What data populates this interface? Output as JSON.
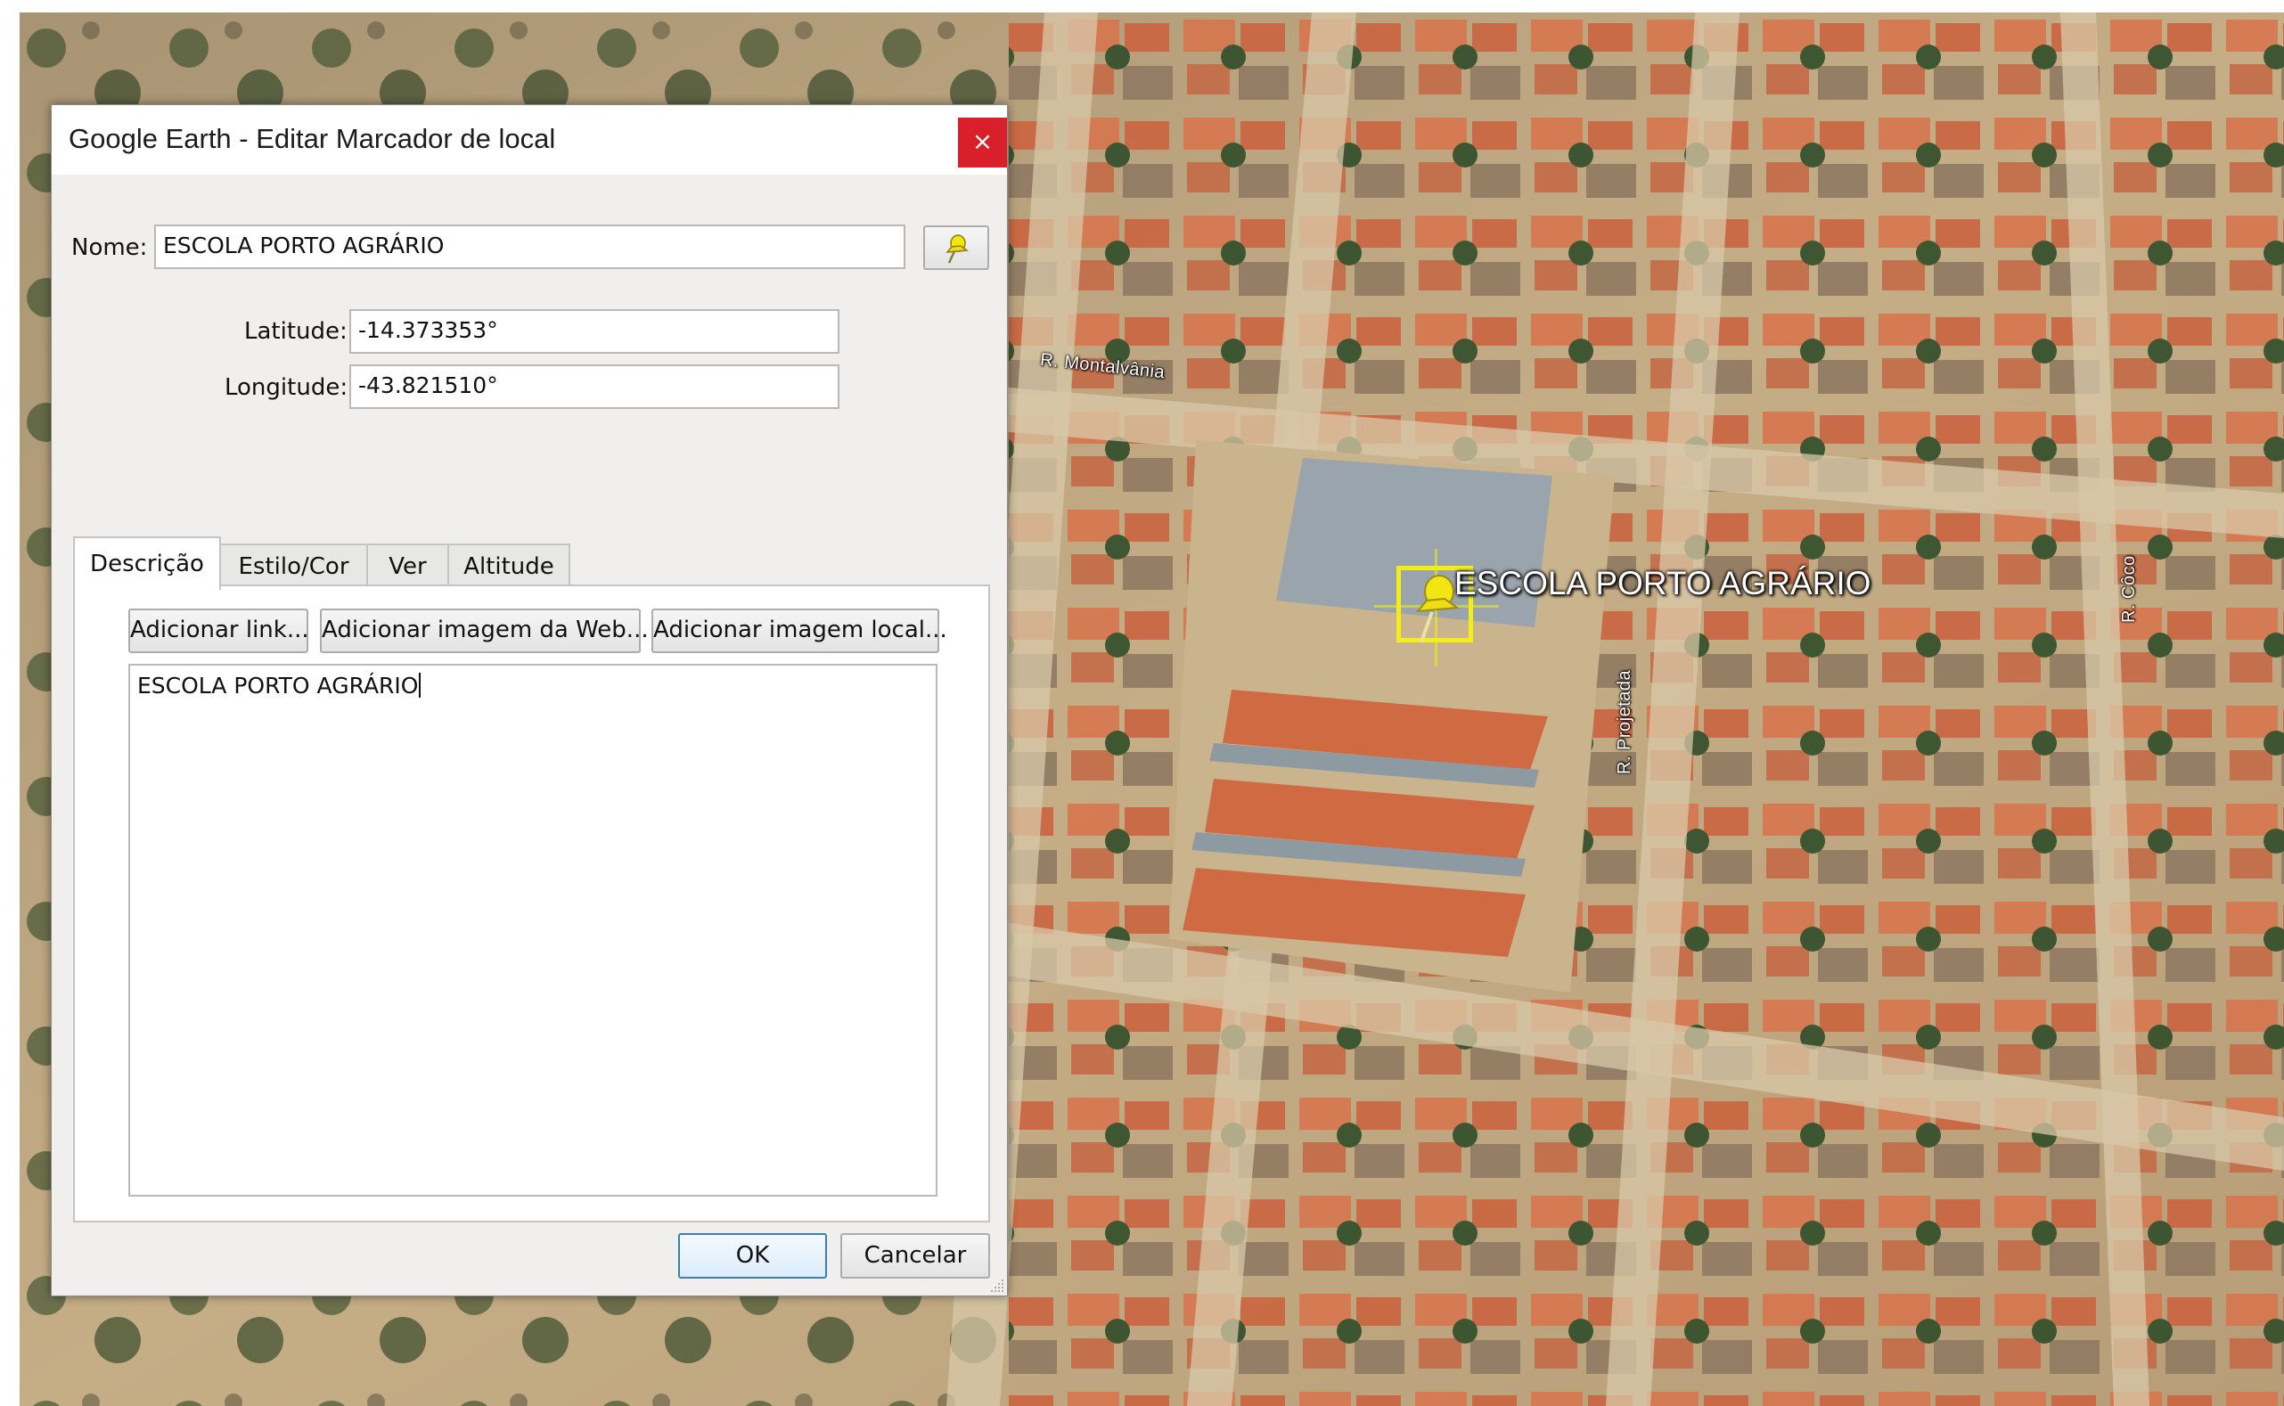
{
  "dialog": {
    "title": "Google Earth - Editar Marcador de local",
    "close_label": "×",
    "name_label": "Nome:",
    "name_value": "ESCOLA PORTO AGRÁRIO",
    "latitude_label": "Latitude:",
    "latitude_value": "-14.373353°",
    "longitude_label": "Longitude:",
    "longitude_value": "-43.821510°",
    "tabs": [
      {
        "label": "Descrição",
        "active": true
      },
      {
        "label": "Estilo/Cor",
        "active": false
      },
      {
        "label": "Ver",
        "active": false
      },
      {
        "label": "Altitude",
        "active": false
      }
    ],
    "add_link_label": "Adicionar link...",
    "add_web_image_label": "Adicionar imagem da Web...",
    "add_local_image_label": "Adicionar imagem local...",
    "description_value": "ESCOLA PORTO AGRÁRIO",
    "ok_label": "OK",
    "cancel_label": "Cancelar"
  },
  "map": {
    "placemark_label": "ESCOLA PORTO AGRÁRIO",
    "placemark_icon": "yellow-pushpin-icon",
    "highlight_color": "#f2ee16",
    "road_labels": {
      "monte_alvania": "R. Montalvânia",
      "projetada": "R. Projetada",
      "coco": "R. Côco"
    }
  }
}
